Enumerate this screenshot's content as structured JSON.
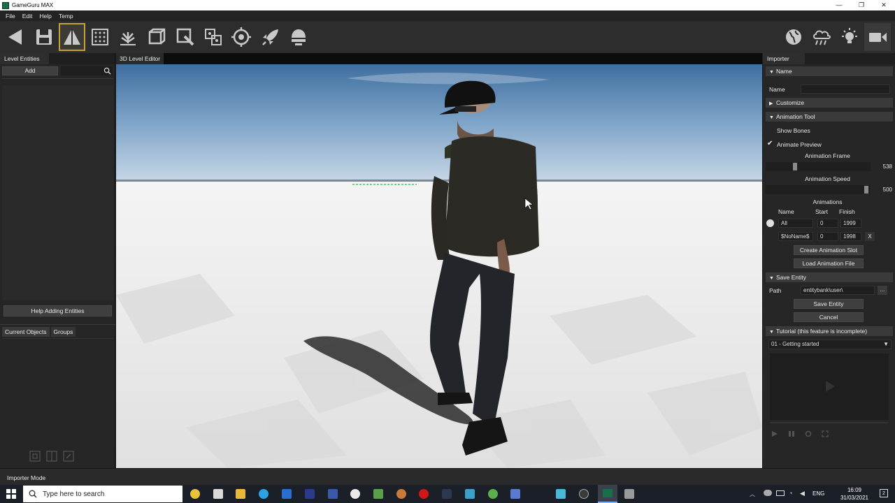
{
  "window": {
    "title": "GameGuru MAX",
    "controls": [
      "—",
      "❐",
      "✕"
    ]
  },
  "menu": [
    "File",
    "Edit",
    "Help",
    "Temp"
  ],
  "left_panel": {
    "tab": "Level Entities",
    "add_label": "Add",
    "help_button": "Help Adding Entities",
    "tabs": [
      "Current Objects",
      "Groups"
    ]
  },
  "viewport": {
    "tab": "3D Level Editor"
  },
  "importer": {
    "tab": "Importer",
    "name_section": "Name",
    "name_label": "Name",
    "name_value": "",
    "customize_section": "Customize",
    "anim_section": "Animation Tool",
    "show_bones": "Show Bones",
    "animate_preview": "Animate Preview",
    "anim_frame_label": "Animation Frame",
    "anim_frame_value": "538",
    "anim_frame_fraction": 0.27,
    "anim_speed_label": "Animation Speed",
    "anim_speed_value": "500",
    "anim_speed_fraction": 0.98,
    "animations_title": "Animations",
    "col_name": "Name",
    "col_start": "Start",
    "col_finish": "Finish",
    "rows": [
      {
        "name": "All",
        "start": "0",
        "finish": "1999",
        "remove": ""
      },
      {
        "name": "$NoName$",
        "start": "0",
        "finish": "1998",
        "remove": "X"
      }
    ],
    "create_slot": "Create Animation Slot",
    "load_file": "Load Animation File",
    "save_section": "Save Entity",
    "path_label": "Path",
    "path_value": "entitybank\\user\\",
    "browse": "...",
    "save_button": "Save Entity",
    "cancel_button": "Cancel",
    "tutorial_section": "Tutorial (this feature is incomplete)",
    "tutorial_select": "01 - Getting started"
  },
  "status": {
    "mode": "Importer Mode"
  },
  "taskbar": {
    "search_placeholder": "Type here to search",
    "lang": "ENG",
    "time": "16:09",
    "date": "31/03/2021",
    "notifications": "2"
  },
  "colors": {
    "accent_active": "#c9a236",
    "toolbar_icon": "#c8c8c8",
    "sky_top": "#3f6fa0",
    "floor": "#e6e6e6"
  }
}
